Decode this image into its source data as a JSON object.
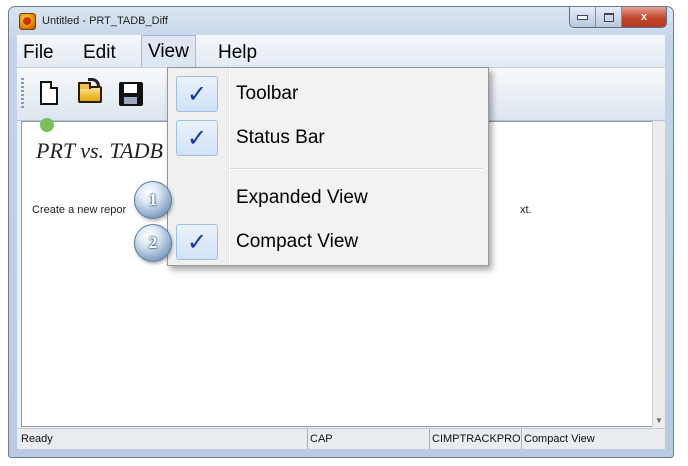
{
  "window": {
    "title": "Untitled - PRT_TADB_Diff",
    "app_icon": "app-icon",
    "buttons": {
      "minimize": "minimize-icon",
      "maximize": "maximize-icon",
      "close": "close-icon",
      "close_glyph": "x"
    }
  },
  "menubar": {
    "items": [
      {
        "label": "File"
      },
      {
        "label": "Edit"
      },
      {
        "label": "View"
      },
      {
        "label": "Help"
      }
    ]
  },
  "toolbar": {
    "buttons": [
      {
        "icon": "new-document-icon"
      },
      {
        "icon": "open-folder-icon"
      },
      {
        "icon": "save-disk-icon"
      }
    ]
  },
  "document": {
    "title": "PRT vs. TADB",
    "text": "Create a new repor",
    "text_tail": "xt."
  },
  "view_menu": {
    "items": [
      {
        "label": "Toolbar",
        "checked": true
      },
      {
        "label": "Status Bar",
        "checked": true
      },
      {
        "label": "Expanded View",
        "checked": false
      },
      {
        "label": "Compact View",
        "checked": true
      }
    ],
    "check_glyph": "✓"
  },
  "callouts": [
    {
      "number": "1"
    },
    {
      "number": "2"
    }
  ],
  "statusbar": {
    "cells": [
      "Ready",
      "CAP",
      "CIMPTRACKPRO",
      "Compact View"
    ]
  },
  "colors": {
    "check": "#1533a3",
    "close_button": "#c2452b",
    "callout": "#7f9ec0"
  }
}
